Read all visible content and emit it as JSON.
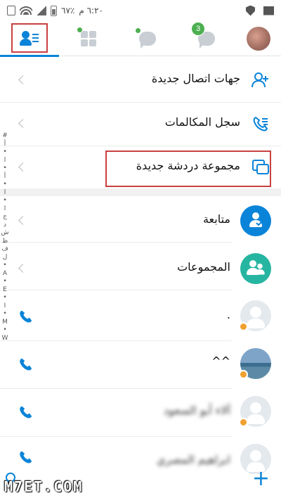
{
  "status_bar": {
    "time": "٦:٢٠ م",
    "battery": "٪٦٧"
  },
  "tabs": [
    {
      "icon": "contacts-icon",
      "active": true
    },
    {
      "icon": "apps-grid-icon",
      "active": false
    },
    {
      "icon": "live-chat-icon",
      "active": false
    },
    {
      "icon": "chats-icon",
      "badge": "3",
      "active": false
    },
    {
      "icon": "profile-avatar",
      "active": false
    }
  ],
  "menu": {
    "new_contacts": "جهات اتصال جديدة",
    "call_log": "سجل المكالمات",
    "new_group_chat": "مجموعة دردشة جديدة",
    "following": "متابعة",
    "groups": "المجموعات"
  },
  "contacts": [
    {
      "name": "."
    },
    {
      "name": "^^"
    },
    {
      "name": "آلاء أبو السعود"
    },
    {
      "name": "ابراهيم المصري"
    }
  ],
  "index_letters": [
    "#",
    "أ",
    "•",
    "ا",
    "•",
    "أ",
    "•",
    "ا",
    "•",
    "ا",
    "ج",
    "د",
    "ش",
    "ظ",
    "ف",
    "ل",
    "•",
    "A",
    "•",
    "E",
    "•",
    "I",
    "•",
    "M",
    "•",
    "W"
  ],
  "watermark": "M7ET.COM",
  "colors": {
    "accent": "#0a84d8",
    "highlight_box": "#c94040",
    "online": "#4caf50"
  }
}
